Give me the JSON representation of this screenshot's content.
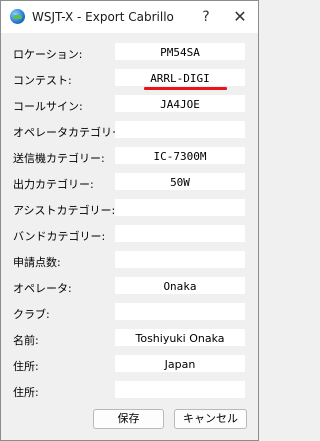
{
  "window": {
    "title": "WSJT-X - Export Cabrillo",
    "help_glyph": "?",
    "close_glyph": "✕"
  },
  "fields": [
    {
      "label": "ロケーション:",
      "value": "PM54SA"
    },
    {
      "label": "コンテスト:",
      "value": "ARRL-DIGI"
    },
    {
      "label": "コールサイン:",
      "value": "JA4JOE"
    },
    {
      "label": "オペレータカテゴリー:",
      "value": ""
    },
    {
      "label": "送信機カテゴリー:",
      "value": "IC-7300M"
    },
    {
      "label": "出力カテゴリー:",
      "value": "50W"
    },
    {
      "label": "アシストカテゴリー:",
      "value": ""
    },
    {
      "label": "バンドカテゴリー:",
      "value": ""
    },
    {
      "label": "申請点数:",
      "value": ""
    },
    {
      "label": "オペレータ:",
      "value": "Onaka"
    },
    {
      "label": "クラブ:",
      "value": ""
    },
    {
      "label": "名前:",
      "value": "Toshiyuki Onaka"
    },
    {
      "label": "住所:",
      "value": "Japan"
    },
    {
      "label": "住所:",
      "value": ""
    }
  ],
  "buttons": {
    "save": "保存",
    "cancel": "キャンセル"
  },
  "colors": {
    "annotation_underline": "#e8141c"
  }
}
